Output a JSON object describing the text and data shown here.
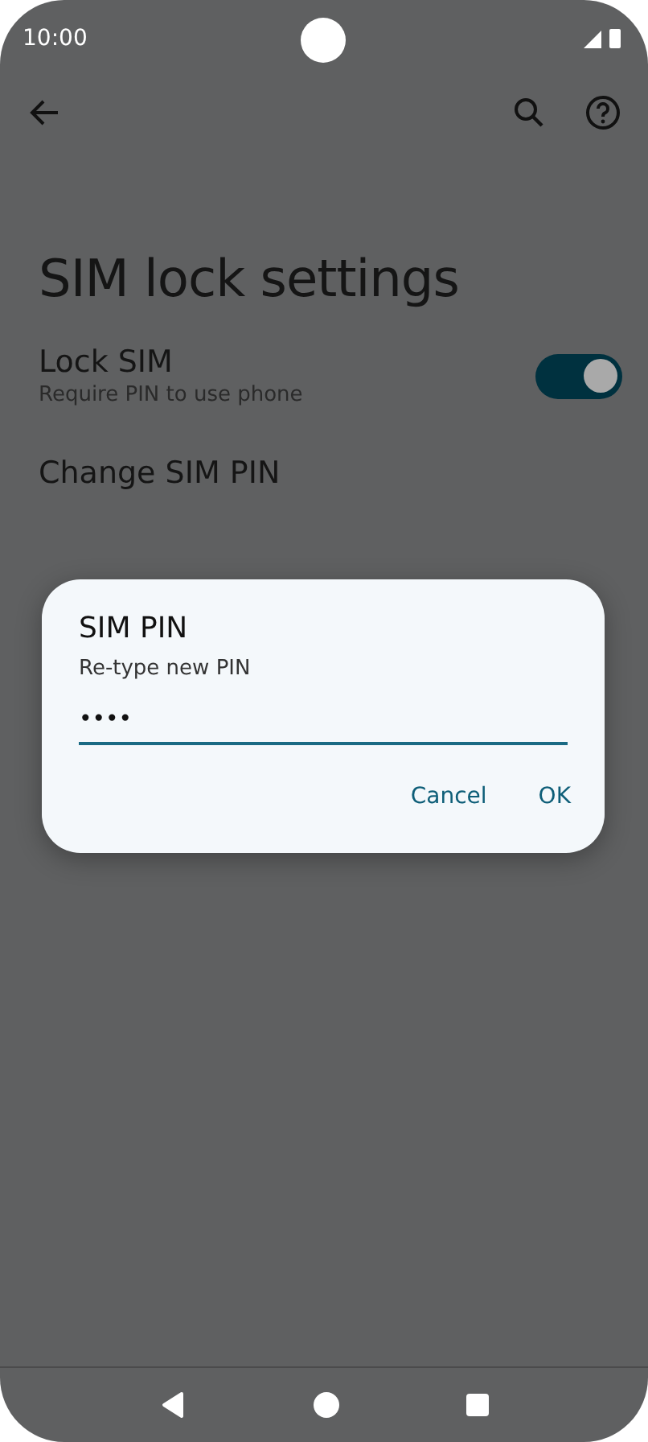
{
  "status_bar": {
    "time": "10:00"
  },
  "title": "SIM lock settings",
  "settings": [
    {
      "kind": "toggle",
      "title": "Lock SIM",
      "subtitle": "Require PIN to use phone",
      "on": true
    },
    {
      "kind": "link",
      "title": "Change SIM PIN"
    }
  ],
  "dialog": {
    "title": "SIM PIN",
    "message": "Re-type new PIN",
    "value": "••••",
    "buttons": [
      "Cancel",
      "OK"
    ]
  }
}
